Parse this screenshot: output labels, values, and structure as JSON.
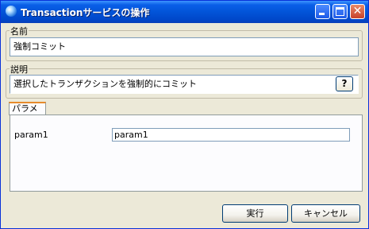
{
  "window": {
    "title": "Transactionサービスの操作",
    "close_glyph": "✕"
  },
  "name_group": {
    "legend": "名前",
    "value": "強制コミット"
  },
  "desc_group": {
    "legend": "説明",
    "value": "選択したトランザクションを強制的にコミット",
    "help_label": "?"
  },
  "params": {
    "tab_label": "パラメータ",
    "rows": [
      {
        "label": "param1",
        "value": "param1"
      }
    ]
  },
  "buttons": {
    "execute": "実行",
    "cancel": "キャンセル"
  }
}
